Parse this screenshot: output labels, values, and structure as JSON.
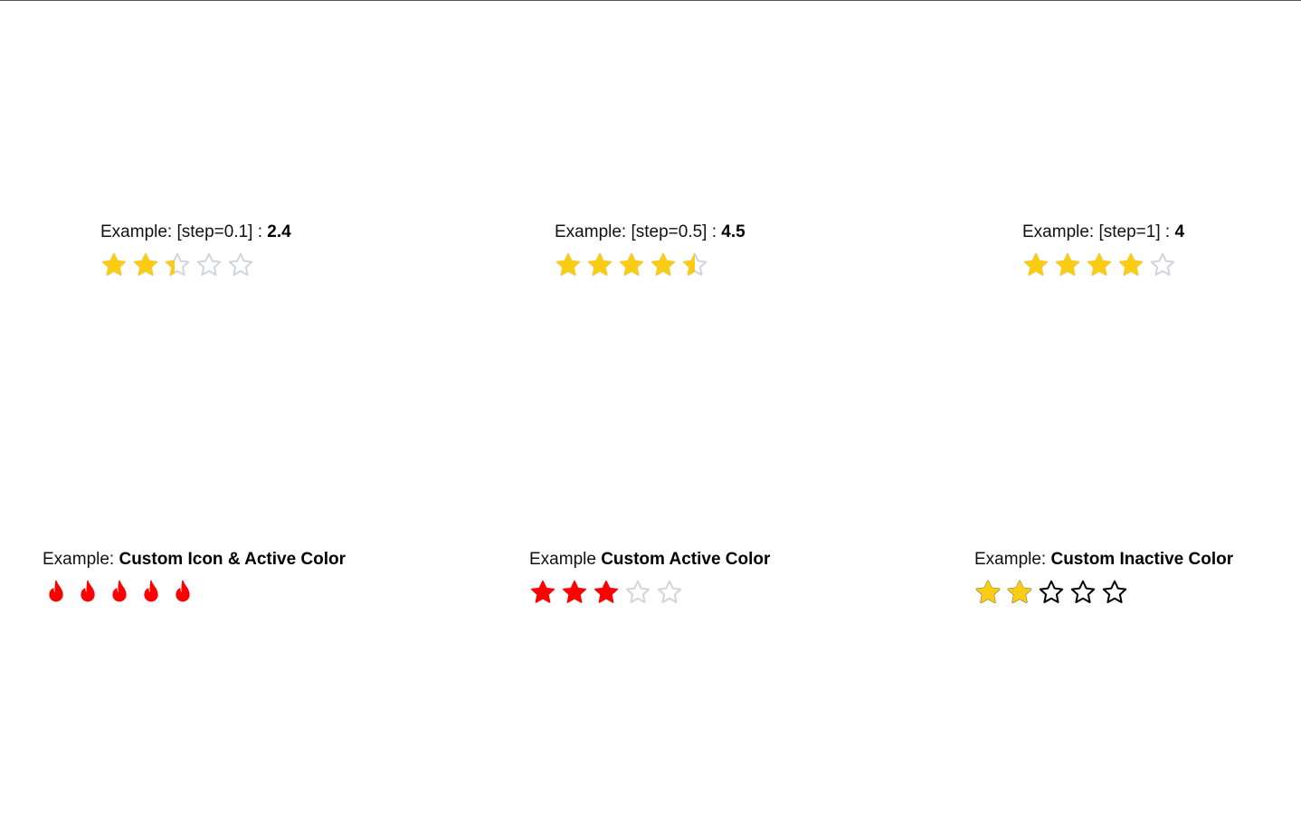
{
  "examples": [
    {
      "id": "ex1",
      "prefix": "Example: [step=0.1] : ",
      "value_text": "2.4",
      "rating": 2.4,
      "max": 5,
      "icon": "star-icon",
      "active_color": "#FACC15",
      "inactive_color": "#D1D5DB",
      "inactive_style": "outline"
    },
    {
      "id": "ex2",
      "prefix": "Example: [step=0.5] : ",
      "value_text": "4.5",
      "rating": 4.5,
      "max": 5,
      "icon": "star-icon",
      "active_color": "#FACC15",
      "inactive_color": "#D1D5DB",
      "inactive_style": "outline"
    },
    {
      "id": "ex3",
      "prefix": "Example: [step=1] : ",
      "value_text": "4",
      "rating": 4,
      "max": 5,
      "icon": "star-icon",
      "active_color": "#FACC15",
      "inactive_color": "#D1D5DB",
      "inactive_style": "outline"
    },
    {
      "id": "ex4",
      "prefix": "Example: ",
      "value_text": "Custom Icon & Active Color",
      "rating": 5,
      "max": 5,
      "icon": "flame-icon",
      "active_color": "#FF0000",
      "inactive_color": "#D1D5DB",
      "inactive_style": "outline"
    },
    {
      "id": "ex5",
      "prefix": "Example ",
      "value_text": "Custom Active Color",
      "rating": 3,
      "max": 5,
      "icon": "star-icon",
      "active_color": "#FF0000",
      "inactive_color": "#D1D5DB",
      "inactive_style": "outline"
    },
    {
      "id": "ex6",
      "prefix": "Example: ",
      "value_text": "Custom Inactive Color",
      "rating": 2,
      "max": 5,
      "icon": "star-icon",
      "active_color": "#FACC15",
      "inactive_color": "#000000",
      "inactive_style": "outline"
    }
  ]
}
